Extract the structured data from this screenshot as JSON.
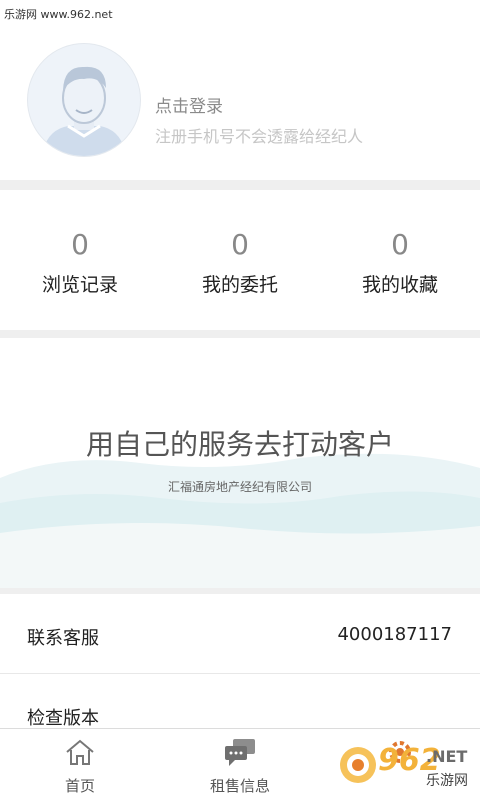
{
  "watermark_top": "乐游网 www.962.net",
  "profile": {
    "login_title": "点击登录",
    "login_subtitle": "注册手机号不会透露给经纪人"
  },
  "stats": [
    {
      "value": "0",
      "label": "浏览记录"
    },
    {
      "value": "0",
      "label": "我的委托"
    },
    {
      "value": "0",
      "label": "我的收藏"
    }
  ],
  "banner": {
    "title": "用自己的服务去打动客户",
    "subtitle": "汇福通房地产经纪有限公司"
  },
  "settings": {
    "service_label": "联系客服",
    "service_phone": "4000187117",
    "version_label": "检查版本"
  },
  "tabbar": [
    {
      "label": "首页",
      "icon": "home-icon"
    },
    {
      "label": "租售信息",
      "icon": "chat-bubbles-icon"
    },
    {
      "label": "",
      "icon": "gear-icon"
    }
  ],
  "watermark_bottom": {
    "num": "962",
    "net": ".NET",
    "cn": "乐游网"
  }
}
